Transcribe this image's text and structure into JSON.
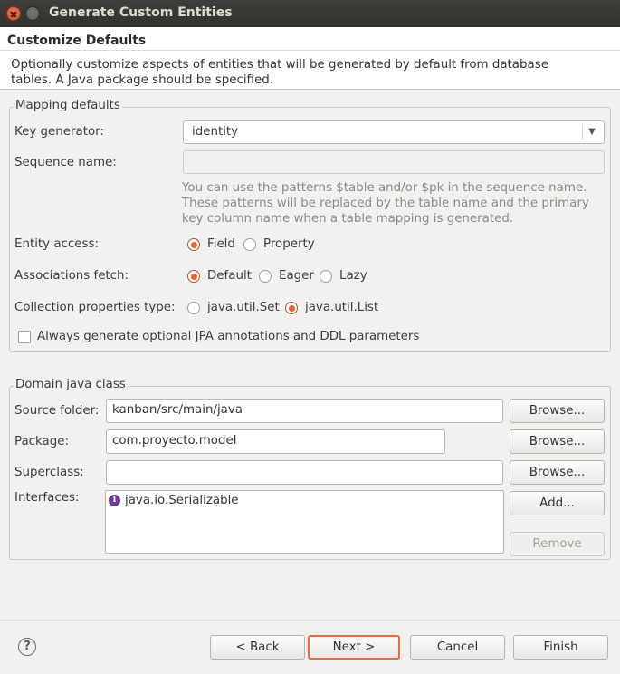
{
  "window": {
    "title": "Generate Custom Entities"
  },
  "header": {
    "title": "Customize Defaults",
    "description": "Optionally customize aspects of entities that will be generated by default from database tables. A Java package should be specified."
  },
  "mapping": {
    "group_label": "Mapping defaults",
    "key_generator": {
      "label": "Key generator:",
      "value": "identity"
    },
    "sequence_name": {
      "label": "Sequence name:",
      "value": ""
    },
    "hint": "You can use the patterns $table and/or $pk in the sequence name. These patterns will be replaced by the table name and the primary key column name when a table mapping is generated.",
    "entity_access": {
      "label": "Entity access:",
      "options": [
        "Field",
        "Property"
      ],
      "selected": "Field"
    },
    "associations_fetch": {
      "label": "Associations fetch:",
      "options": [
        "Default",
        "Eager",
        "Lazy"
      ],
      "selected": "Default"
    },
    "collection_type": {
      "label": "Collection properties type:",
      "options": [
        "java.util.Set",
        "java.util.List"
      ],
      "selected": "java.util.List"
    },
    "always_generate": {
      "label": "Always generate optional JPA annotations and DDL parameters",
      "checked": false
    }
  },
  "domain": {
    "group_label": "Domain java class",
    "source_folder": {
      "label": "Source folder:",
      "value": "kanban/src/main/java"
    },
    "package": {
      "label": "Package:",
      "value": "com.proyecto.model"
    },
    "superclass": {
      "label": "Superclass:",
      "value": ""
    },
    "interfaces": {
      "label": "Interfaces:",
      "items": [
        "java.io.Serializable"
      ]
    },
    "browse_label": "Browse...",
    "add_label": "Add...",
    "remove_label": "Remove"
  },
  "footer": {
    "back_label": "< Back",
    "next_label": "Next >",
    "cancel_label": "Cancel",
    "finish_label": "Finish"
  },
  "colors": {
    "accent": "#e9622a",
    "titlebar": "#3a3935",
    "interface_icon": "#6a3e9a"
  }
}
